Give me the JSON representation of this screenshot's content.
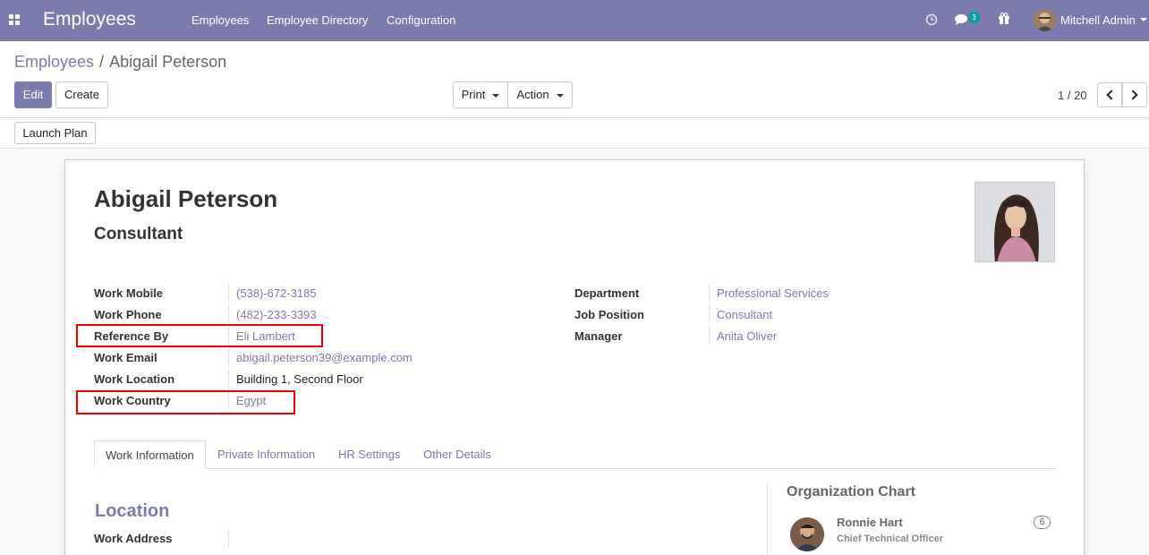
{
  "navbar": {
    "brand": "Employees",
    "menu": [
      "Employees",
      "Employee Directory",
      "Configuration"
    ],
    "messages_count": "3",
    "user_name": "Mitchell Admin"
  },
  "breadcrumb": {
    "parent": "Employees",
    "separator": "/",
    "current": "Abigail Peterson"
  },
  "buttons": {
    "edit": "Edit",
    "create": "Create",
    "print": "Print",
    "action": "Action",
    "launch_plan": "Launch Plan"
  },
  "pager": {
    "value": "1 / 20"
  },
  "employee": {
    "name": "Abigail Peterson",
    "job_title": "Consultant"
  },
  "left_fields": [
    {
      "label": "Work Mobile",
      "value": "(538)-672-3185"
    },
    {
      "label": "Work Phone",
      "value": "(482)-233-3393"
    },
    {
      "label": "Reference By",
      "value": "Eli Lambert"
    },
    {
      "label": "Work Email",
      "value": "abigail.peterson39@example.com"
    },
    {
      "label": "Work Location",
      "value": "Building 1, Second Floor"
    },
    {
      "label": "Work Country",
      "value": "Egypt"
    }
  ],
  "right_fields": [
    {
      "label": "Department",
      "value": "Professional Services"
    },
    {
      "label": "Job Position",
      "value": "Consultant"
    },
    {
      "label": "Manager",
      "value": "Anita Oliver"
    }
  ],
  "tabs": [
    "Work Information",
    "Private Information",
    "HR Settings",
    "Other Details"
  ],
  "work_info": {
    "location_title": "Location",
    "work_address_label": "Work Address"
  },
  "org_chart": {
    "title": "Organization Chart",
    "person_name": "Ronnie Hart",
    "person_job": "Chief Technical Officer",
    "subordinates": "6"
  },
  "colors": {
    "navbar": "#7c7bad",
    "link": "#7c7bad",
    "highlight": "#e00000"
  }
}
